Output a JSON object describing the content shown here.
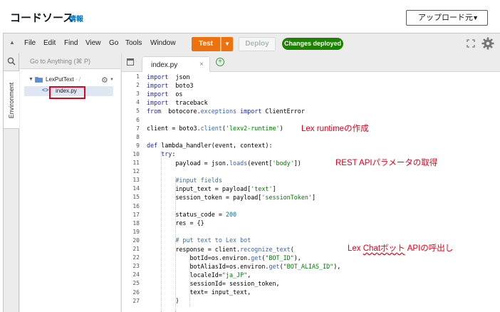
{
  "header": {
    "title": "コードソース",
    "info_link": "情報",
    "upload_button": "アップロード元",
    "upload_caret": "▼"
  },
  "menubar": {
    "items": [
      "File",
      "Edit",
      "Find",
      "View",
      "Go",
      "Tools",
      "Window"
    ],
    "test_label": "Test",
    "deploy_label": "Deploy",
    "status_badge": "Changes deployed",
    "accent_color": "#ec7211",
    "status_color": "#1d8102"
  },
  "sidebar": {
    "search_placeholder": "Go to Anything (⌘ P)",
    "environment_tab": "Environment",
    "folder": {
      "name": "LexPutText",
      "suffix": "- /"
    },
    "file": {
      "name": "index.py"
    }
  },
  "editor": {
    "tab_label": "index.py",
    "tab_close": "×",
    "new_tab": "+",
    "lines": [
      {
        "n": "1",
        "t": [
          [
            "kw",
            "import"
          ],
          [
            "",
            "  json"
          ]
        ]
      },
      {
        "n": "2",
        "t": [
          [
            "kw",
            "import"
          ],
          [
            "",
            "  boto3"
          ]
        ]
      },
      {
        "n": "3",
        "t": [
          [
            "kw",
            "import"
          ],
          [
            "",
            "  os"
          ]
        ]
      },
      {
        "n": "4",
        "t": [
          [
            "kw",
            "import"
          ],
          [
            "",
            "  traceback"
          ]
        ]
      },
      {
        "n": "5",
        "t": [
          [
            "kw",
            "from"
          ],
          [
            "",
            "  botocore."
          ],
          [
            "fn",
            "exceptions"
          ],
          [
            "",
            " "
          ],
          [
            "kw",
            "import"
          ],
          [
            "",
            " ClientError"
          ]
        ]
      },
      {
        "n": "6",
        "t": []
      },
      {
        "n": "7",
        "t": [
          [
            "",
            "client = boto3."
          ],
          [
            "fn",
            "client"
          ],
          [
            "",
            "("
          ],
          [
            "str",
            "'lexv2-runtime'"
          ],
          [
            "",
            ")"
          ]
        ]
      },
      {
        "n": "8",
        "t": []
      },
      {
        "n": "9",
        "t": [
          [
            "kw",
            "def"
          ],
          [
            "",
            " lambda_handler(event, context):"
          ]
        ]
      },
      {
        "n": "10",
        "t": [
          [
            "",
            "    "
          ],
          [
            "kw",
            "try"
          ],
          [
            "",
            ":"
          ]
        ]
      },
      {
        "n": "11",
        "t": [
          [
            "",
            "        payload = json."
          ],
          [
            "fn",
            "loads"
          ],
          [
            "",
            "(event["
          ],
          [
            "str",
            "'body'"
          ],
          [
            "",
            "])"
          ]
        ]
      },
      {
        "n": "12",
        "t": []
      },
      {
        "n": "13",
        "t": [
          [
            "",
            "        "
          ],
          [
            "cm",
            "#input fields"
          ]
        ]
      },
      {
        "n": "14",
        "t": [
          [
            "",
            "        input_text = payload["
          ],
          [
            "str",
            "'text'"
          ],
          [
            "",
            "]"
          ]
        ]
      },
      {
        "n": "15",
        "t": [
          [
            "",
            "        session_token = payload["
          ],
          [
            "str",
            "'sessionToken'"
          ],
          [
            "",
            "]"
          ]
        ]
      },
      {
        "n": "16",
        "t": []
      },
      {
        "n": "17",
        "t": [
          [
            "",
            "        status_code = "
          ],
          [
            "num",
            "200"
          ]
        ]
      },
      {
        "n": "18",
        "t": [
          [
            "",
            "        res = {}"
          ]
        ]
      },
      {
        "n": "19",
        "t": []
      },
      {
        "n": "20",
        "t": [
          [
            "",
            "        "
          ],
          [
            "cm",
            "# put text to Lex bot"
          ]
        ]
      },
      {
        "n": "21",
        "t": [
          [
            "",
            "        response = client."
          ],
          [
            "fn",
            "recognize_text"
          ],
          [
            "",
            "("
          ]
        ]
      },
      {
        "n": "22",
        "t": [
          [
            "",
            "            botId=os.environ."
          ],
          [
            "fn",
            "get"
          ],
          [
            "",
            "("
          ],
          [
            "str",
            "\"BOT_ID\""
          ],
          [
            "",
            "),"
          ]
        ]
      },
      {
        "n": "23",
        "t": [
          [
            "",
            "            botAliasId=os.environ."
          ],
          [
            "fn",
            "get"
          ],
          [
            "",
            "("
          ],
          [
            "str",
            "\"BOT_ALIAS_ID\""
          ],
          [
            "",
            "),"
          ]
        ]
      },
      {
        "n": "24",
        "t": [
          [
            "",
            "            localeId="
          ],
          [
            "str",
            "\"ja_JP\""
          ],
          [
            "",
            ","
          ]
        ]
      },
      {
        "n": "25",
        "t": [
          [
            "",
            "            sessionId= session_token,"
          ]
        ]
      },
      {
        "n": "26",
        "t": [
          [
            "",
            "            text= input_text,"
          ]
        ]
      },
      {
        "n": "27",
        "t": [
          [
            "",
            "        )"
          ]
        ]
      }
    ]
  },
  "annotations": {
    "runtime": "Lex runtimeの作成",
    "params": "REST APIパラメータの取得",
    "chatbot_prefix": "Lex ",
    "chatbot_squiggle": "Chatボット",
    "chatbot_suffix": " APIの呼出し",
    "color": "#e0001a"
  }
}
